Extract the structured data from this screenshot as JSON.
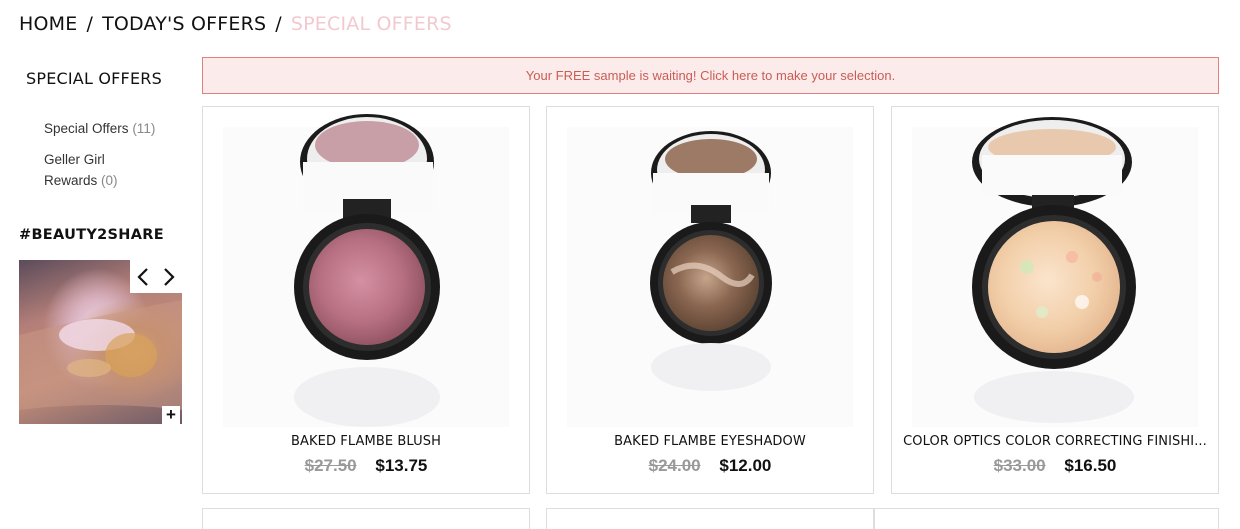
{
  "breadcrumb": {
    "home": "HOME",
    "offers": "TODAY'S OFFERS",
    "current": "SPECIAL OFFERS",
    "separator": "/"
  },
  "sidebar": {
    "title": "SPECIAL OFFERS",
    "filters": [
      {
        "label": "Special Offers",
        "count": "(11)"
      },
      {
        "label": "Geller Girl Rewards",
        "count": "(0)"
      }
    ],
    "hashtag": "#BEAUTY2SHARE",
    "plus": "+"
  },
  "banner": {
    "text": "Your FREE sample is waiting! Click here to make your selection."
  },
  "products": [
    {
      "name": "BAKED FLAMBE BLUSH",
      "old_price": "$27.50",
      "price": "$13.75"
    },
    {
      "name": "BAKED FLAMBE EYESHADOW",
      "old_price": "$24.00",
      "price": "$12.00"
    },
    {
      "name": "COLOR OPTICS COLOR CORRECTING FINISHI...",
      "old_price": "$33.00",
      "price": "$16.50"
    }
  ],
  "colors": {
    "breadcrumb_current": "#f1c9cf",
    "banner_bg": "#fbeceb",
    "banner_border": "#e0817e",
    "banner_text": "#c95d55"
  },
  "icons": [
    "chevron-left-icon",
    "chevron-right-icon",
    "plus-icon"
  ]
}
